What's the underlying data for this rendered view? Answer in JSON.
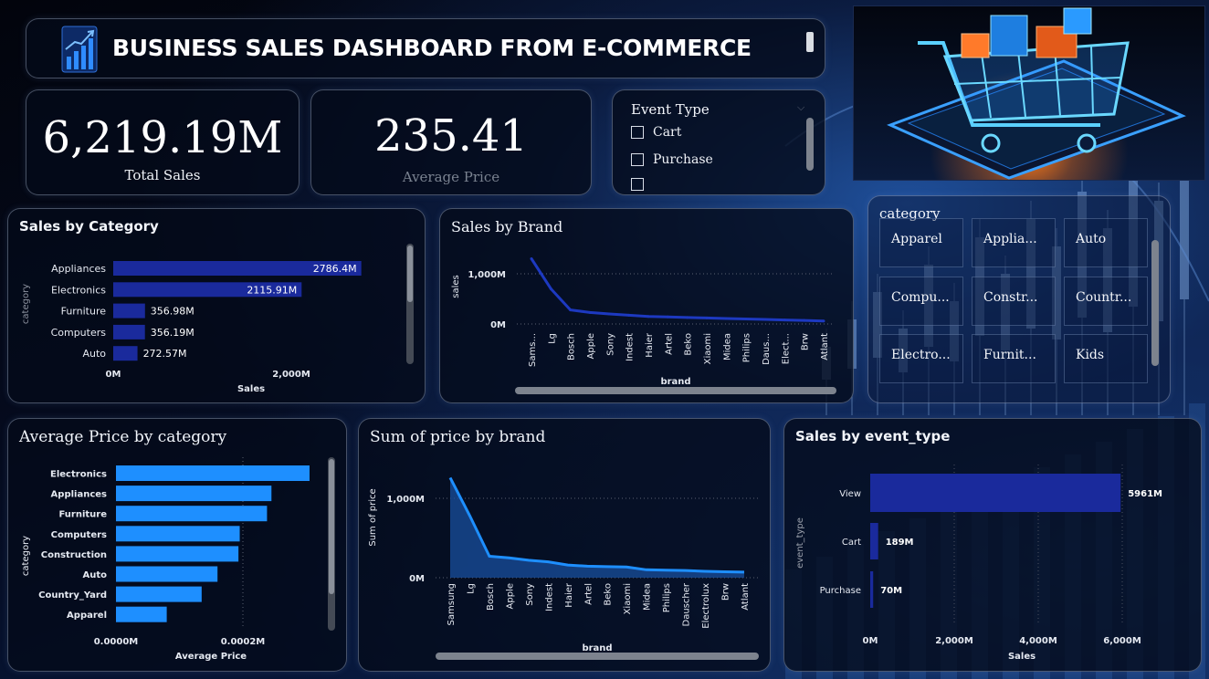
{
  "header": {
    "title": "BUSINESS SALES DASHBOARD FROM E-COMMERCE",
    "icon": "bar-chart-growth-icon"
  },
  "kpis": {
    "total_sales": {
      "value": "6,219.19M",
      "label": "Total Sales"
    },
    "avg_price": {
      "value": "235.41",
      "label": "Average Price"
    }
  },
  "event_slicer": {
    "title": "Event Type",
    "options": [
      "Cart",
      "Purchase"
    ]
  },
  "category_slicer": {
    "title": "category",
    "tiles": [
      "Apparel",
      "Applia...",
      "Auto",
      "Compu...",
      "Constr...",
      "Countr...",
      "Electro...",
      "Furnit...",
      "Kids"
    ]
  },
  "hero_image": {
    "description_icon": "shopping-cart-on-phone-icon"
  },
  "colors": {
    "bar_dark": "#1a2a9c",
    "bar_bright": "#1e8fff",
    "line": "#1d39c0",
    "area": "#1a4f9e"
  },
  "charts": {
    "sales_by_category": {
      "title": "Sales by Category",
      "xlabel": "Sales",
      "ylabel": "category",
      "xticks": [
        "0M",
        "2,000M"
      ],
      "value_labels": [
        "2786.4M",
        "2115.91M",
        "356.98M",
        "356.19M",
        "272.57M"
      ]
    },
    "sales_by_brand": {
      "title": "Sales by Brand",
      "xlabel": "brand",
      "ylabel": "sales",
      "yticks": [
        "1,000M",
        "0M"
      ],
      "xticks": [
        "Sams...",
        "Lg",
        "Bosch",
        "Apple",
        "Sony",
        "Indest",
        "Haier",
        "Artel",
        "Beko",
        "Xiaomi",
        "Midea",
        "Philips",
        "Daus...",
        "Elect...",
        "Brw",
        "Atlant"
      ]
    },
    "avg_price_by_category": {
      "title": "Average Price by category",
      "xlabel": "Average Price",
      "ylabel": "category",
      "xticks": [
        "0.0000M",
        "0.0002M"
      ]
    },
    "sum_price_by_brand": {
      "title": "Sum of price by brand",
      "xlabel": "brand",
      "ylabel": "Sum of price",
      "yticks": [
        "1,000M",
        "0M"
      ],
      "xticks": [
        "Samsung",
        "Lg",
        "Bosch",
        "Apple",
        "Sony",
        "Indest",
        "Haier",
        "Artel",
        "Beko",
        "Xiaomi",
        "Midea",
        "Philips",
        "Dauscher",
        "Electrolux",
        "Brw",
        "Atlant"
      ]
    },
    "sales_by_event": {
      "title": "Sales by event_type",
      "xlabel": "Sales",
      "ylabel": "event_type",
      "xticks": [
        "0M",
        "2,000M",
        "4,000M",
        "6,000M"
      ],
      "value_labels": [
        "5961M",
        "189M",
        "70M"
      ]
    }
  },
  "chart_data": [
    {
      "type": "bar",
      "title": "Sales by Category",
      "categories": [
        "Appliances",
        "Electronics",
        "Furniture",
        "Computers",
        "Auto"
      ],
      "values": [
        2786.4,
        2115.91,
        356.98,
        356.19,
        272.57
      ],
      "xlabel": "Sales",
      "ylabel": "category",
      "xlim": [
        0,
        3000
      ]
    },
    {
      "type": "line",
      "title": "Sales by Brand",
      "categories": [
        "Sams...",
        "Lg",
        "Bosch",
        "Apple",
        "Sony",
        "Indest",
        "Haier",
        "Artel",
        "Beko",
        "Xiaomi",
        "Midea",
        "Philips",
        "Daus...",
        "Elect...",
        "Brw",
        "Atlant"
      ],
      "values": [
        1300,
        700,
        280,
        230,
        200,
        175,
        150,
        140,
        130,
        120,
        110,
        100,
        90,
        80,
        70,
        60
      ],
      "xlabel": "brand",
      "ylabel": "sales",
      "ylim": [
        0,
        1400
      ]
    },
    {
      "type": "bar",
      "title": "Average Price by category",
      "categories": [
        "Electronics",
        "Appliances",
        "Furniture",
        "Computers",
        "Construction",
        "Auto",
        "Country_Yard",
        "Apparel"
      ],
      "values": [
        0.000305,
        0.000245,
        0.000238,
        0.000195,
        0.000193,
        0.00016,
        0.000135,
        8e-05
      ],
      "xlabel": "Average Price",
      "ylabel": "category",
      "xlim": [
        0,
        0.00033
      ]
    },
    {
      "type": "area",
      "title": "Sum of price by brand",
      "categories": [
        "Samsung",
        "Lg",
        "Bosch",
        "Apple",
        "Sony",
        "Indest",
        "Haier",
        "Artel",
        "Beko",
        "Xiaomi",
        "Midea",
        "Philips",
        "Dauscher",
        "Electrolux",
        "Brw",
        "Atlant"
      ],
      "values": [
        1260,
        780,
        270,
        250,
        220,
        200,
        160,
        145,
        140,
        135,
        100,
        95,
        90,
        80,
        75,
        70
      ],
      "xlabel": "brand",
      "ylabel": "Sum of price",
      "ylim": [
        0,
        1300
      ]
    },
    {
      "type": "bar",
      "title": "Sales by event_type",
      "categories": [
        "View",
        "Cart",
        "Purchase"
      ],
      "values": [
        5961,
        189,
        70
      ],
      "xlabel": "Sales",
      "ylabel": "event_type",
      "xlim": [
        0,
        6500
      ]
    }
  ]
}
